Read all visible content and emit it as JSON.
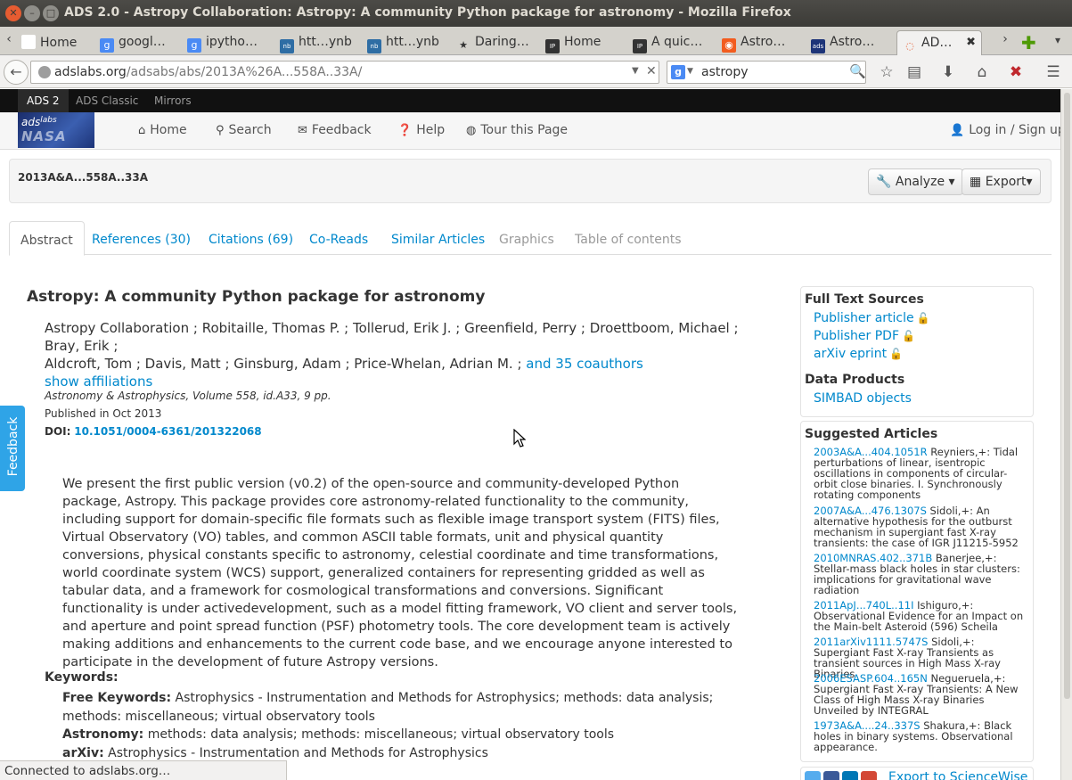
{
  "window": {
    "title": "ADS 2.0 - Astropy Collaboration: Astropy: A community Python package for astronomy - Mozilla Firefox"
  },
  "browser_tabs": [
    {
      "label": "Home",
      "icon": "page-icon"
    },
    {
      "label": "googl…",
      "icon": "google-icon"
    },
    {
      "label": "ipytho…",
      "icon": "google-icon"
    },
    {
      "label": "htt…ynb",
      "icon": "nbviewer-icon"
    },
    {
      "label": "htt…ynb",
      "icon": "nbviewer-icon"
    },
    {
      "label": "Daring…",
      "icon": "star-icon"
    },
    {
      "label": "Home",
      "icon": "ipython-icon"
    },
    {
      "label": "A quic…",
      "icon": "ipython-icon"
    },
    {
      "label": "Astro…",
      "icon": "astropy-icon"
    },
    {
      "label": "Astro…",
      "icon": "ads-icon"
    },
    {
      "label": "AD…",
      "icon": "loading-icon",
      "active": true
    }
  ],
  "navbar": {
    "url_host": "adslabs.org",
    "url_path": "/adsabs/abs/2013A%26A...558A..33A/",
    "search_value": "astropy"
  },
  "ads_topbar": {
    "items": [
      "ADS 2",
      "ADS Classic",
      "Mirrors"
    ]
  },
  "ads_header": {
    "logo_text": "ads",
    "logo_sup": "labs",
    "logo_sub": "NASA",
    "nav": [
      "Home",
      "Search",
      "Feedback",
      "Help",
      "Tour this Page"
    ],
    "login": "Log in / Sign up"
  },
  "record": {
    "bibcode": "2013A&A...558A..33A",
    "analyze_label": "Analyze",
    "export_label": "Export"
  },
  "content_tabs": [
    {
      "label": "Abstract",
      "state": "active"
    },
    {
      "label": "References (30)",
      "state": "link"
    },
    {
      "label": "Citations (69)",
      "state": "link"
    },
    {
      "label": "Co-Reads",
      "state": "link"
    },
    {
      "label": "Similar Articles",
      "state": "link"
    },
    {
      "label": "Graphics",
      "state": "disabled"
    },
    {
      "label": "Table of contents",
      "state": "disabled"
    }
  ],
  "paper": {
    "title": "Astropy: A community Python package for astronomy",
    "authors_line1": "Astropy Collaboration ; Robitaille, Thomas P. ; Tollerud, Erik J. ; Greenfield, Perry ; Droettboom, Michael ; Bray, Erik ;",
    "authors_line2": "Aldcroft, Tom ; Davis, Matt ; Ginsburg, Adam ; Price-Whelan, Adrian M. ;",
    "coauthors_link": "and 35 coauthors",
    "show_affiliations": "show affiliations",
    "journal": "Astronomy & Astrophysics, Volume 558, id.A33, 9 pp.",
    "published": "Published in Oct 2013",
    "doi_label": "DOI:",
    "doi_value": "10.1051/0004-6361/201322068",
    "abstract": "We present the first public version (v0.2) of the open-source and community-developed Python package, Astropy. This package provides core astronomy-related functionality to the community, including support for domain-specific file formats such as flexible image transport system (FITS) files, Virtual Observatory (VO) tables, and common ASCII table formats, unit and physical quantity conversions, physical constants specific to astronomy, celestial coordinate and time transformations, world coordinate system (WCS) support, generalized containers for representing gridded as well as tabular data, and a framework for cosmological transformations and conversions. Significant functionality is under activedevelopment, such as a model fitting framework, VO client and server tools, and aperture and point spread function (PSF) photometry tools. The core development team is actively making additions and enhancements to the current code base, and we encourage anyone interested to participate in the development of future Astropy versions.",
    "keywords_heading": "Keywords:",
    "free_kw_label": "Free Keywords:",
    "free_kw": "Astrophysics - Instrumentation and Methods for Astrophysics; methods: data analysis; methods: miscellaneous; virtual observatory tools",
    "astro_kw_label": "Astronomy:",
    "astro_kw": "methods: data analysis; methods: miscellaneous; virtual observatory tools",
    "arxiv_kw_label": "arXiv:",
    "arxiv_kw": "Astrophysics - Instrumentation and Methods for Astrophysics"
  },
  "sidebar": {
    "fulltext_heading": "Full Text Sources",
    "fulltext_links": [
      "Publisher article",
      "Publisher PDF",
      "arXiv eprint"
    ],
    "data_heading": "Data Products",
    "data_links": [
      "SIMBAD objects"
    ],
    "suggested_heading": "Suggested Articles",
    "suggested": [
      {
        "code": "2003A&A...404.1051R",
        "text": " Reyniers,+: Tidal perturbations of linear, isentropic oscillations in components of circular-orbit close binaries. I. Synchronously rotating components"
      },
      {
        "code": "2007A&A...476.1307S",
        "text": " Sidoli,+: An alternative hypothesis for the outburst mechanism in supergiant fast X-ray transients: the case of IGR J11215-5952"
      },
      {
        "code": "2010MNRAS.402..371B",
        "text": " Banerjee,+: Stellar-mass black holes in star clusters: implications for gravitational wave radiation"
      },
      {
        "code": "2011ApJ...740L..11I",
        "text": " Ishiguro,+: Observational Evidence for an Impact on the Main-belt Asteroid (596) Scheila"
      },
      {
        "code": "2011arXiv1111.5747S",
        "text": " Sidoli,+: Supergiant Fast X-ray Transients as transient sources in High Mass X-ray Binaries"
      },
      {
        "code": "2006ESASP.604..165N",
        "text": " Negueruela,+: Supergiant Fast X-ray Transients: A New Class of High Mass X-ray Binaries Unveiled by INTEGRAL"
      },
      {
        "code": "1973A&A....24..337S",
        "text": " Shakura,+: Black holes in binary systems. Observational appearance."
      }
    ],
    "share_text": "Export to ScienceWise"
  },
  "feedback_tab": "Feedback",
  "statusbar": "Connected to adslabs.org…",
  "colors": {
    "link": "#0088cc",
    "feedback_tab": "#2fa4e7",
    "oa_icon": "#f0901c"
  }
}
